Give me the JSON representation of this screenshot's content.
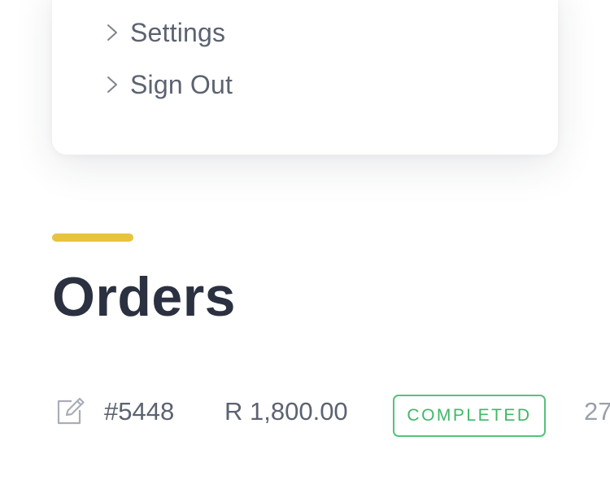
{
  "menu": {
    "items": [
      {
        "label": "Settings",
        "icon": "chevron-right-icon"
      },
      {
        "label": "Sign Out",
        "icon": "chevron-right-icon"
      }
    ]
  },
  "orders": {
    "title": "Orders",
    "accent_color": "#e8c33f",
    "rows": [
      {
        "id": "#5448",
        "amount": "R 1,800.00",
        "status": "COMPLETED",
        "status_color": "#3fb868",
        "date_partial": "27",
        "icon": "edit-icon"
      }
    ]
  }
}
